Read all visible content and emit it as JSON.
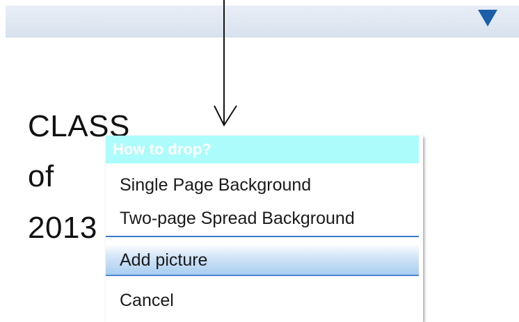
{
  "toolbar": {
    "dropdown_icon": "triangle-down-icon",
    "accent_color": "#1a5fa8"
  },
  "page": {
    "lines": [
      "CLASS",
      "of",
      "2013"
    ]
  },
  "drop_menu": {
    "header": "How to drop?",
    "header_color": "#adfcfc",
    "items": [
      {
        "label": "Single Page Background"
      },
      {
        "label": "Two-page Spread Background"
      },
      {
        "label": "Add picture",
        "highlighted": true
      },
      {
        "label": "Cancel"
      }
    ]
  },
  "cursor": {
    "icon": "down-arrow-icon"
  }
}
